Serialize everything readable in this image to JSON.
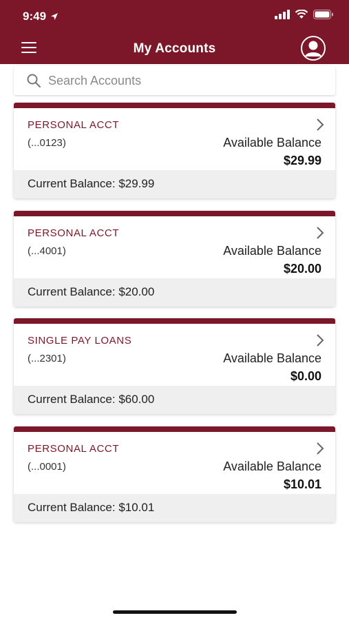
{
  "status_bar": {
    "time": "9:49"
  },
  "header": {
    "title": "My Accounts"
  },
  "search": {
    "placeholder": "Search Accounts"
  },
  "accounts": [
    {
      "name": "PERSONAL ACCT",
      "number": "(...0123)",
      "available_label": "Available Balance",
      "available": "$29.99",
      "current_label": "Current Balance:",
      "current": "$29.99"
    },
    {
      "name": "PERSONAL ACCT",
      "number": "(...4001)",
      "available_label": "Available Balance",
      "available": "$20.00",
      "current_label": "Current Balance:",
      "current": "$20.00"
    },
    {
      "name": "SINGLE PAY LOANS",
      "number": "(...2301)",
      "available_label": "Available Balance",
      "available": "$0.00",
      "current_label": "Current Balance:",
      "current": "$60.00"
    },
    {
      "name": "PERSONAL ACCT",
      "number": "(...0001)",
      "available_label": "Available Balance",
      "available": "$10.01",
      "current_label": "Current Balance:",
      "current": "$10.01"
    }
  ],
  "colors": {
    "brand": "#7b1728",
    "footer_bg": "#efefef"
  },
  "icons": [
    "location-arrow-icon",
    "signal-icon",
    "wifi-icon",
    "battery-icon",
    "menu-icon",
    "user-avatar-icon",
    "search-icon",
    "chevron-right-icon"
  ]
}
